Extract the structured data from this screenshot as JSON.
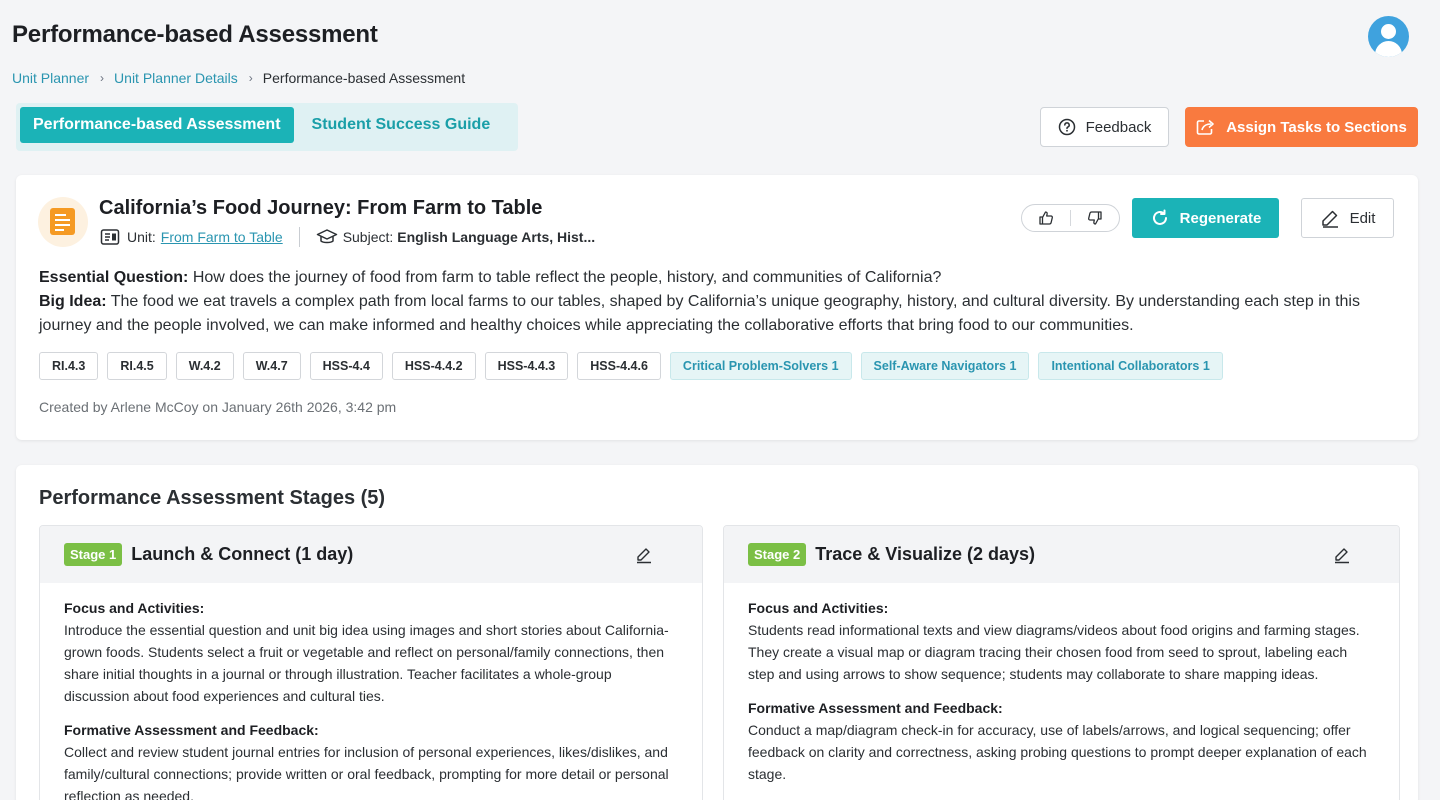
{
  "header": {
    "title": "Performance-based Assessment"
  },
  "breadcrumb": {
    "items": [
      "Unit Planner",
      "Unit Planner Details",
      "Performance-based Assessment"
    ]
  },
  "tabs": [
    "Performance-based Assessment",
    "Student Success Guide"
  ],
  "actions": {
    "feedback": "Feedback",
    "assign": "Assign Tasks to Sections"
  },
  "assessment": {
    "title": "California’s Food Journey: From Farm to Table",
    "unit_label": "Unit:",
    "unit_link": "From Farm to Table",
    "subject_label": "Subject:",
    "subject_value": "English Language Arts, Hist...",
    "regenerate": "Regenerate",
    "edit": "Edit",
    "essential_question_label": "Essential Question:",
    "essential_question": "How does the journey of food from farm to table reflect the people, history, and communities of California?",
    "big_idea_label": "Big Idea:",
    "big_idea": "The food we eat travels a complex path from local farms to our tables, shaped by California’s unique geography, history, and cultural diversity. By understanding each step in this journey and the people involved, we can make informed and healthy choices while appreciating the collaborative efforts that bring food to our communities.",
    "standards": [
      "RI.4.3",
      "RI.4.5",
      "W.4.2",
      "W.4.7",
      "HSS-4.4",
      "HSS-4.4.2",
      "HSS-4.4.3",
      "HSS-4.4.6"
    ],
    "competencies": [
      "Critical Problem-Solvers 1",
      "Self-Aware Navigators 1",
      "Intentional Collaborators 1"
    ],
    "created": "Created by Arlene McCoy on January 26th 2026, 3:42 pm"
  },
  "stages": {
    "title": "Performance Assessment Stages (5)",
    "items": [
      {
        "badge": "Stage 1",
        "title": "Launch & Connect (1 day)",
        "focus_label": "Focus and Activities:",
        "focus": "Introduce the essential question and unit big idea using images and short stories about California-grown foods. Students select a fruit or vegetable and reflect on personal/family connections, then share initial thoughts in a journal or through illustration. Teacher facilitates a whole-group discussion about food experiences and cultural ties.",
        "formative_label": "Formative Assessment and Feedback:",
        "formative": "Collect and review student journal entries for inclusion of personal experiences, likes/dislikes, and family/cultural connections; provide written or oral feedback, prompting for more detail or personal reflection as needed."
      },
      {
        "badge": "Stage 2",
        "title": "Trace & Visualize (2 days)",
        "focus_label": "Focus and Activities:",
        "focus": "Students read informational texts and view diagrams/videos about food origins and farming stages. They create a visual map or diagram tracing their chosen food from seed to sprout, labeling each step and using arrows to show sequence; students may collaborate to share mapping ideas.",
        "formative_label": "Formative Assessment and Feedback:",
        "formative": "Conduct a map/diagram check-in for accuracy, use of labels/arrows, and logical sequencing; offer feedback on clarity and correctness, asking probing questions to prompt deeper explanation of each stage."
      }
    ]
  },
  "colors": {
    "teal": "#1bb3b7",
    "orange": "#f97a3f",
    "link": "#2a95b0",
    "stage_badge": "#7bbf45"
  }
}
